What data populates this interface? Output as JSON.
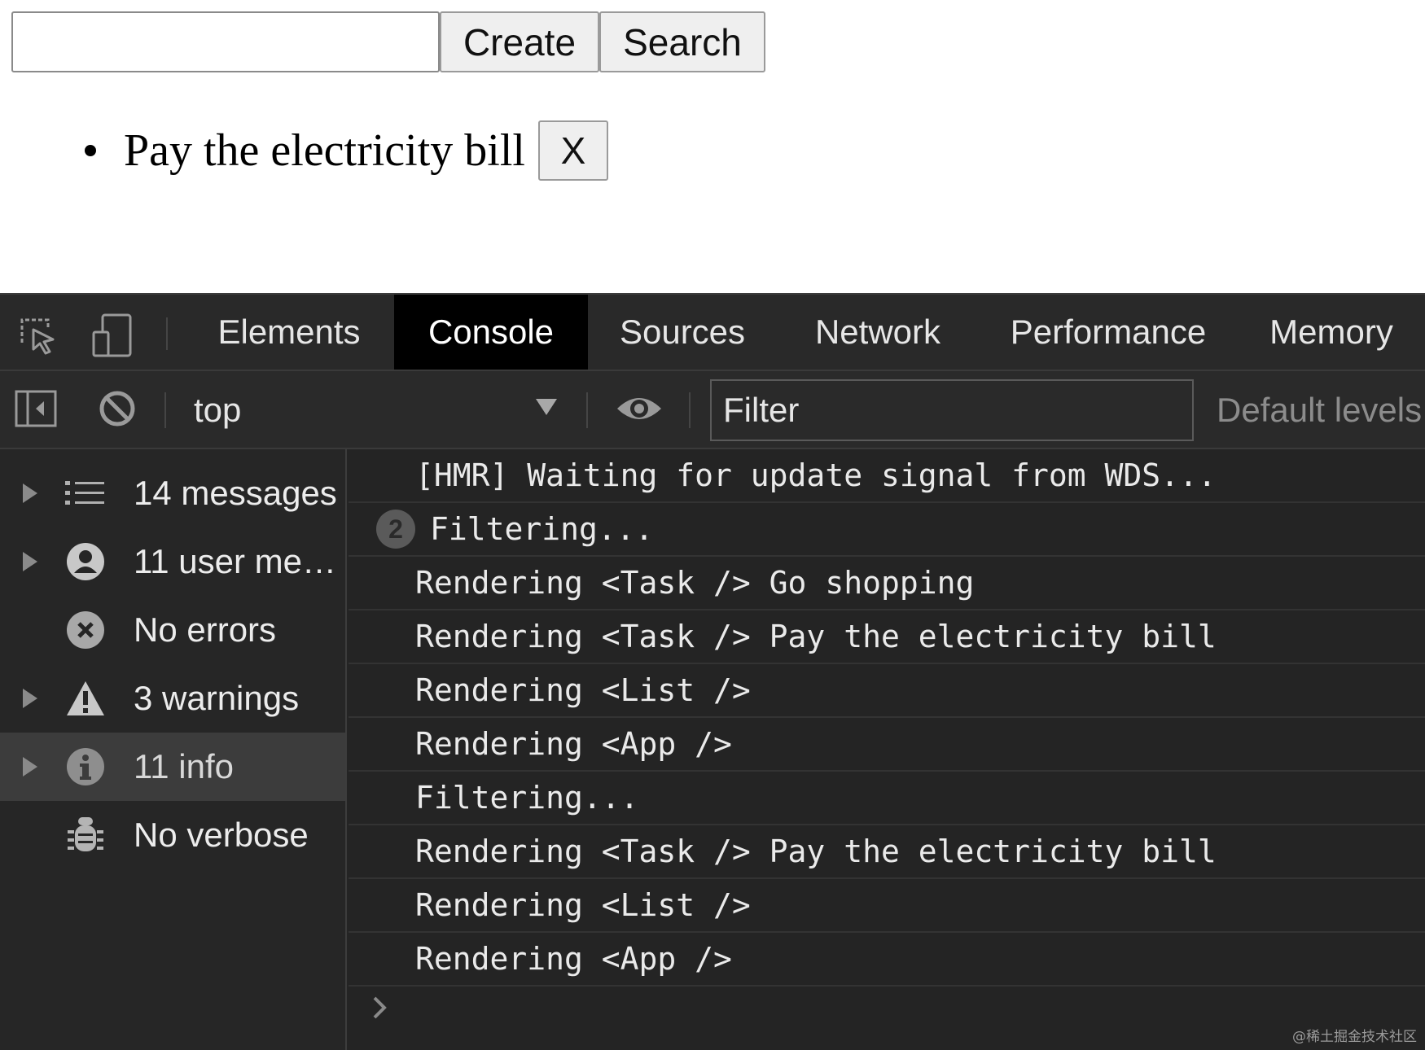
{
  "app": {
    "input": {
      "value": "",
      "placeholder": ""
    },
    "create_label": "Create",
    "search_label": "Search",
    "tasks": [
      {
        "text": "Pay the electricity bill",
        "delete_label": "X"
      }
    ]
  },
  "devtools": {
    "tabs": [
      {
        "label": "Elements",
        "active": false
      },
      {
        "label": "Console",
        "active": true
      },
      {
        "label": "Sources",
        "active": false
      },
      {
        "label": "Network",
        "active": false
      },
      {
        "label": "Performance",
        "active": false
      },
      {
        "label": "Memory",
        "active": false
      }
    ],
    "toolbar": {
      "context": "top",
      "filter_placeholder": "Filter",
      "levels": "Default levels"
    },
    "sidebar": [
      {
        "label": "14 messages",
        "icon": "list-icon",
        "expandable": true,
        "selected": false
      },
      {
        "label": "11 user me…",
        "icon": "user-icon",
        "expandable": true,
        "selected": false
      },
      {
        "label": "No errors",
        "icon": "error-icon",
        "expandable": false,
        "selected": false
      },
      {
        "label": "3 warnings",
        "icon": "warning-icon",
        "expandable": true,
        "selected": false
      },
      {
        "label": "11 info",
        "icon": "info-icon",
        "expandable": true,
        "selected": true
      },
      {
        "label": "No verbose",
        "icon": "bug-icon",
        "expandable": false,
        "selected": false
      }
    ],
    "console_messages": [
      {
        "text": "[HMR] Waiting for update signal from WDS...",
        "count": null
      },
      {
        "text": "Filtering...",
        "count": "2"
      },
      {
        "text": "Rendering <Task /> Go shopping",
        "count": null
      },
      {
        "text": "Rendering <Task /> Pay the electricity bill",
        "count": null
      },
      {
        "text": "Rendering <List />",
        "count": null
      },
      {
        "text": "Rendering <App />",
        "count": null
      },
      {
        "text": "Filtering...",
        "count": null
      },
      {
        "text": "Rendering <Task /> Pay the electricity bill",
        "count": null
      },
      {
        "text": "Rendering <List />",
        "count": null
      },
      {
        "text": "Rendering <App />",
        "count": null
      }
    ]
  },
  "watermark": "@稀土掘金技术社区"
}
